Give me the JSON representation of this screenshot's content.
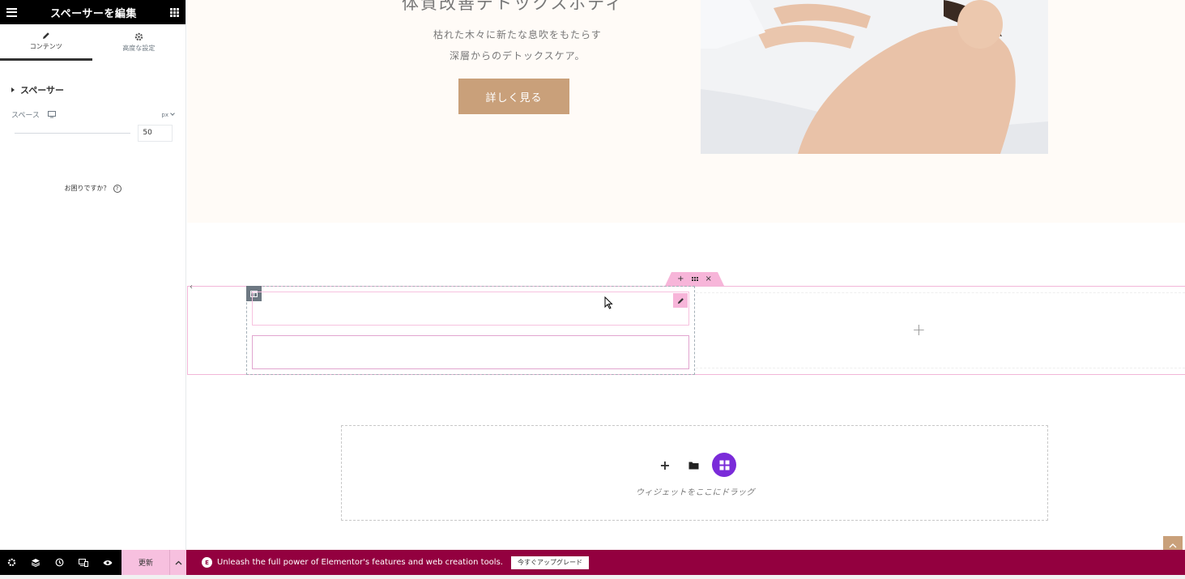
{
  "panel": {
    "title": "スペーサーを編集",
    "tabs": [
      {
        "label": "コンテンツ",
        "icon": "pencil-icon",
        "active": true
      },
      {
        "label": "高度な設定",
        "icon": "gear-icon",
        "active": false
      }
    ],
    "section_title": "スペーサー",
    "control": {
      "label": "スペース",
      "unit": "px",
      "value": "50",
      "slider_fraction": 0.0
    },
    "help_text": "お困りですか？",
    "help_icon": "?"
  },
  "hero": {
    "title": "体質改善デトックスボディ",
    "line1": "枯れた木々に新たな息吹をもたらす",
    "line2": "深層からのデトックスケア。",
    "button_label": "詳しく見る"
  },
  "section_handle": {
    "add": "+",
    "close": "×"
  },
  "add_section": {
    "plus": "+",
    "drag_text": "ウィジェットをここにドラッグ"
  },
  "footer": {
    "update_label": "更新"
  },
  "promo": {
    "logo": "E",
    "message": "Unleash the full power of Elementor's features and web creation tools.",
    "button_label": "今すぐアップグレード"
  },
  "colors": {
    "accent_pink": "#f7b5d9",
    "promo_bg": "#93003f",
    "hero_button": "#c9a07a",
    "kit_button": "#7a2bd9"
  }
}
